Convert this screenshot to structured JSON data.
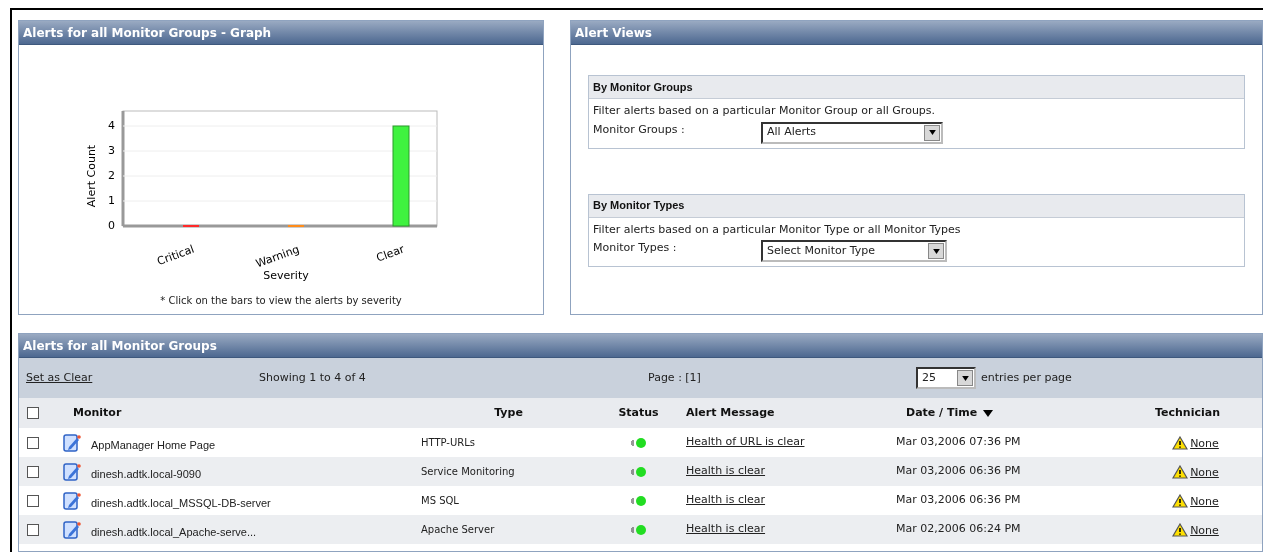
{
  "graph_panel": {
    "title": "Alerts for all Monitor Groups - Graph",
    "chart_data": {
      "type": "bar",
      "xlabel": "Severity",
      "ylabel": "Alert Count",
      "categories": [
        "Critical",
        "Warning",
        "Clear"
      ],
      "yticks": [
        0,
        1,
        2,
        3,
        4
      ],
      "ylim": [
        0,
        4.6
      ],
      "grid": true,
      "colors": [
        "#ff2a2a",
        "#ff8c1a",
        "#3ff23f"
      ],
      "series": [
        {
          "values": [
            0,
            0,
            4
          ]
        }
      ]
    },
    "note": "* Click on the bars to view the alerts by severity"
  },
  "views_panel": {
    "title": "Alert Views",
    "sections": [
      {
        "heading": "By Monitor Groups",
        "description": "Filter alerts based on a particular Monitor Group or all Groups.",
        "label": "Monitor Groups :",
        "value": "All Alerts"
      },
      {
        "heading": "By Monitor Types",
        "description": "Filter alerts based on a particular Monitor Type or all Monitor Types",
        "label": "Monitor Types :",
        "value": "Select Monitor Type"
      }
    ]
  },
  "alerts_panel": {
    "title": "Alerts for all Monitor Groups",
    "action_link": "Set as Clear",
    "showing": "Showing 1 to 4 of 4",
    "page": "Page : [1]",
    "per_page_value": "25",
    "per_page_label": "entries per page",
    "select_all_checked": false,
    "columns": [
      "Monitor",
      "Type",
      "Status",
      "Alert Message",
      "Date / Time",
      "Technician"
    ],
    "rows": [
      {
        "checked": false,
        "monitor": "AppManager Home Page",
        "type": "HTTP-URLs",
        "color": "#22dd22",
        "message": "Health of URL is clear",
        "time": "Mar 03,2006 07:36 PM",
        "technician": "None"
      },
      {
        "checked": false,
        "monitor": "dinesh.adtk.local-9090",
        "type": "Service Monitoring",
        "color": "#22dd22",
        "message": "Health is clear",
        "time": "Mar 03,2006 06:36 PM",
        "technician": "None"
      },
      {
        "checked": false,
        "monitor": "dinesh.adtk.local_MSSQL-DB-server",
        "type": "MS SQL",
        "color": "#22dd22",
        "message": "Health is clear",
        "time": "Mar 03,2006 06:36 PM",
        "technician": "None"
      },
      {
        "checked": false,
        "monitor": "dinesh.adtk.local_Apache-serve...",
        "type": "Apache Server",
        "color": "#22dd22",
        "message": "Health is clear",
        "time": "Mar 02,2006 06:24 PM",
        "technician": "None"
      }
    ]
  }
}
